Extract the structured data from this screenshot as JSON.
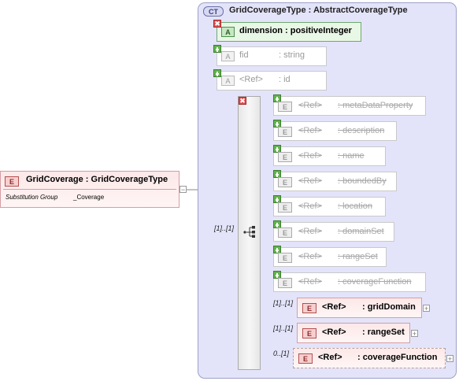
{
  "complex_type": {
    "badge": "CT",
    "title": "GridCoverageType : AbstractCoverageType"
  },
  "root": {
    "badge": "E",
    "title": "GridCoverage : GridCoverageType",
    "sub_label": "Substitution Group",
    "sub_value": "_Coverage"
  },
  "attributes": [
    {
      "badge": "A",
      "name": "dimension",
      "type": ": positiveInteger",
      "active": true
    },
    {
      "badge": "A",
      "name": "fid",
      "type": ": string",
      "active": false
    },
    {
      "badge": "A",
      "name": "<Ref>",
      "type": ": id",
      "active": false
    }
  ],
  "sequence": {
    "occurrence": "[1]..[1]"
  },
  "elements": [
    {
      "badge": "E",
      "ref": "<Ref>",
      "name": ": metaDataProperty",
      "active": false
    },
    {
      "badge": "E",
      "ref": "<Ref>",
      "name": ": description",
      "active": false
    },
    {
      "badge": "E",
      "ref": "<Ref>",
      "name": ": name",
      "active": false
    },
    {
      "badge": "E",
      "ref": "<Ref>",
      "name": ": boundedBy",
      "active": false
    },
    {
      "badge": "E",
      "ref": "<Ref>",
      "name": ": location",
      "active": false
    },
    {
      "badge": "E",
      "ref": "<Ref>",
      "name": ": domainSet",
      "active": false
    },
    {
      "badge": "E",
      "ref": "<Ref>",
      "name": ": rangeSet",
      "active": false
    },
    {
      "badge": "E",
      "ref": "<Ref>",
      "name": ": coverageFunction",
      "active": false
    },
    {
      "badge": "E",
      "ref": "<Ref>",
      "name": ": gridDomain",
      "active": true,
      "occurrence": "[1]..[1]"
    },
    {
      "badge": "E",
      "ref": "<Ref>",
      "name": ": rangeSet",
      "active": true,
      "occurrence": "[1]..[1]"
    },
    {
      "badge": "E",
      "ref": "<Ref>",
      "name": ": coverageFunction",
      "active": true,
      "occurrence": "0..[1]",
      "optional": true
    }
  ],
  "symbols": {
    "plus": "+",
    "minus": "−",
    "remove": "✖",
    "sequence_icon": "sequence-icon"
  }
}
